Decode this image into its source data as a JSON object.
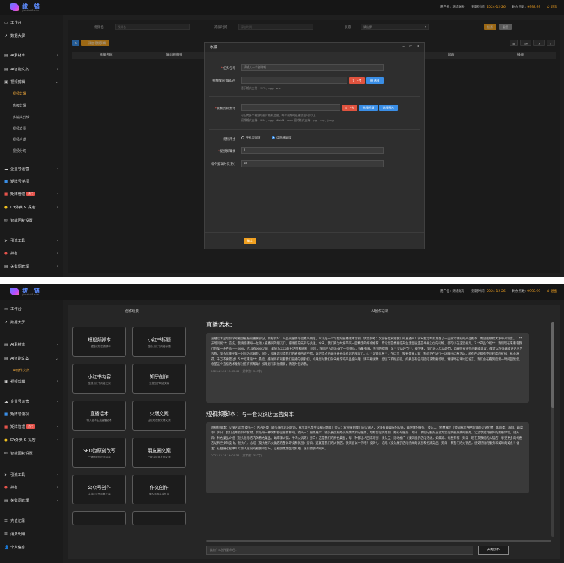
{
  "brand": {
    "name": "拔 锚",
    "sub": "yunxiu88.com"
  },
  "topbar": {
    "user_label": "用户名:",
    "user_name": "测试账号",
    "expire_label": "到期时间:",
    "expire_value": "2024-12-26",
    "balance_label": "剩余点数:",
    "balance_value": "9998.99",
    "logout_label": "退出"
  },
  "sidebar": {
    "items": [
      {
        "label": "工作台",
        "icon": "desktop-icon"
      },
      {
        "label": "数据大屏",
        "icon": "chart-icon"
      },
      {
        "label": "AI素材库",
        "icon": "folder-icon"
      },
      {
        "label": "AI智能文案",
        "icon": "doc-icon"
      },
      {
        "label": "视频剪辑",
        "icon": "film-icon"
      },
      {
        "label": "视频剪辑",
        "sub": true,
        "active": true
      },
      {
        "label": "高级剪辑",
        "sub": true
      },
      {
        "label": "多镜头剪辑",
        "sub": true
      },
      {
        "label": "视频去重",
        "sub": true
      },
      {
        "label": "视频合成",
        "sub": true
      },
      {
        "label": "视频分切",
        "sub": true
      },
      {
        "label": "企业号运营",
        "icon": "cloud-icon"
      },
      {
        "label": "矩阵号授权",
        "icon": "key-icon"
      },
      {
        "label": "矩阵管理",
        "icon": "grid-icon",
        "tag": "热门"
      },
      {
        "label": "DY外卖 & 探店",
        "icon": "globe-icon"
      },
      {
        "label": "智能回复设置",
        "icon": "mail-icon"
      },
      {
        "label": "引流工具",
        "icon": "send-icon"
      },
      {
        "label": "排名",
        "icon": "rank-icon"
      },
      {
        "label": "关键词管理",
        "icon": "doc-icon"
      }
    ]
  },
  "search": {
    "name_label": "视频名",
    "name_placeholder": "视频名",
    "time_label": "添加时间",
    "time_placeholder": "添加时间",
    "status_label": "状态",
    "status_value": "请选择",
    "search_button": "搜索",
    "reset_button": "重置"
  },
  "toolbar": {
    "add_button": "+ 添加视频剪辑"
  },
  "table": {
    "columns": [
      "视频名称",
      "输出视频数",
      "",
      "状态",
      "操作"
    ]
  },
  "modal": {
    "title": "添加",
    "task_label": "任务名称",
    "task_placeholder": "请输入一个名称吧",
    "bgm_label": "视频配背景BGM",
    "bgm_upload": "上传",
    "bgm_choose": "选择",
    "bgm_hint": "音乐格式支持：MP3、ogg、wav",
    "material_label": "视频剪辑素材",
    "material_upload": "上传",
    "material_video": "选择视频",
    "material_image": "选择图片",
    "material_hint1": "可上传多个视频与图片随机组合，每个视频时长建议在5秒以上",
    "material_hint2": "视频格式支持：MP4、ogg、WebM、mov  图片格式支持：jpg、png、jpeg",
    "size_label": "视频尺寸",
    "size_opt1": "手机竖屏版",
    "size_opt2": "电脑横屏版",
    "count_label": "视频剪辑数",
    "count_value": "1",
    "duration_label": "每个剪辑时长(秒)",
    "duration_value": "30",
    "confirm_button": "确定"
  },
  "panel2": {
    "sidebar_sub": "AI创作文案",
    "sidebar_bottom": [
      {
        "label": "充值记录",
        "icon": "list-icon"
      },
      {
        "label": "消费明细",
        "icon": "list-icon"
      },
      {
        "label": "个人信息",
        "icon": "user-icon"
      }
    ],
    "left_title": "创作场景",
    "right_title": "AI创作记录",
    "cards": [
      {
        "title": "短视频脚本",
        "sub": "一键生成短视频脚本"
      },
      {
        "title": "小红书标题",
        "sub": "生成小红书风格标题"
      },
      {
        "title": "小红书内容",
        "sub": "生成小红书风格文案"
      },
      {
        "title": "知乎创作",
        "sub": "生成知乎风格文案"
      },
      {
        "title": "直播话术",
        "sub": "输入要求生成直播话术"
      },
      {
        "title": "火爆文案",
        "sub": "生成短视频火爆文案"
      },
      {
        "title": "SEO伪原创改写",
        "sub": "一键伪原创改写内容"
      },
      {
        "title": "朋友圈文案",
        "sub": "一键生成朋友圈文案"
      },
      {
        "title": "公众号创作",
        "sub": "生成公众号风格文章"
      },
      {
        "title": "作文创作",
        "sub": "输入标题生成作文"
      }
    ],
    "sections": [
      {
        "title": "直播话术：",
        "body": "直播话术是现如今短视频直播的重要部分，目标受众、产品或服务等因素来确定，以下是一个可能的直播话术示例，供您参考：欢迎各位来到我们的直播间！今天我为大家准备了一些非常精彩的产品推荐，希望能够给大家带来惊喜。1.**开场问候**：首先，我要感谢每一位进入直播间的朋友们，感谢您的支持与关注。今天，我们将为大家带来一些精选的好物推荐，不论您是想要提升生活品质还是寻找心仪的礼物，都可以在这里找到。2.**产品介绍**：我们现在来看看我们的第一件产品——XXX，它具有XXX功能，能够为XXX的生活带来便利！同时，我们还为您准备了一些赠品，数量有限，先到先得哦！3.**互动环节**：接下来，我们进入互动环节，如果您有任何问题或建议，都可以在弹幕或评论区告诉我，我会尽量在第一时间为您解答。同时，如果您觉得我们的直播内容不错，请记得点击关注并分享给您的朋友们。4.**促销优惠**：在这里，我要提醒大家，我们正在进行一场限时优惠活动，所有产品都有不同程度的折扣，机会难得，千万不要错过！5.**结束语**：最后，感谢所有观看我们直播的朋友们，如果您对我们今天推荐的产品感兴趣，请不要犹豫，赶快下单购买吧。如果您有任何疑问或需要帮助，请随时在评论区留言，我们会在看到后第一时间回复您。希望这个直播话术能够对您有所帮助！如果您有其他需要，请随时告诉我。",
        "time": "2023-12-28 15:43:48",
        "length": "(总字数：343字)"
      },
      {
        "title": "短视频脚本：",
        "subtitle": "写一套火锅店运营脚本",
        "body": "短视频脚本：火锅店运营 镜头一：店内环境（镜头展示店内装饰，展示客人享受美食的场景）旁白：欢迎来到我们的火锅店，这里有最美味的火锅，最热情的服务。镜头二：食材展示（镜头展示各种新鲜的火锅食材，如肉类、海鲜、蔬菜等）旁白：我们选用新鲜的食材，保证每一种食材都是最新鲜的。镜头三：服务展示（镜头展示服务员热情周到的服务，为顾客提供周到、贴心的服务）旁白：我们的服务员会为您提供最热情的服务，让您享受到最好的用餐体验。镜头四：特色菜品介绍（镜头展示店内的特色菜品，如麻辣火锅、牛肉火锅等）旁白：这是我们的特色菜品，每一种都让人回味无穷。镜头五：活动推广（镜头展示店内活动，如满减、优惠券等）旁白：现在来我们的火锅店，享受更多的优惠活动和更多的美食。镜头六：总结（镜头展示火锅店的整体环境和氛围）旁白：这就是我们的火锅店，快来尝试一下吧！镜头七：结尾（镜头展示店内热闹的氛围和招牌菜品）旁白：来我们的火锅店，感受热情的服务和美味的美食！备注：在拍摄过程中可以加入店内的视频和音乐，让视频更加生动有趣，吸引更多的观众。",
        "time": "2023-12-28 16:04:38",
        "length": "(总字数：352字)"
      }
    ],
    "input_placeholder": "说点什么创作要求吧...",
    "send_button": "开始创作"
  }
}
